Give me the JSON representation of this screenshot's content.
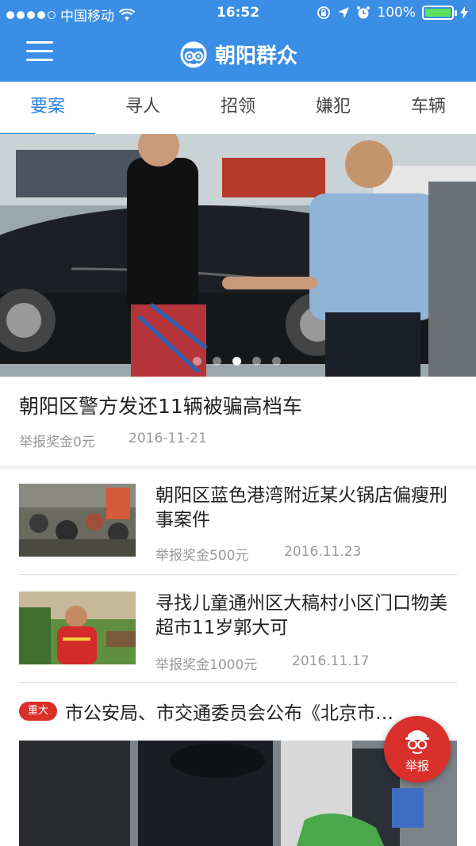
{
  "status": {
    "carrier": "中国移动",
    "time": "16:52",
    "battery": "100%"
  },
  "header": {
    "title": "朝阳群众"
  },
  "tabs": [
    "要案",
    "寻人",
    "招领",
    "嫌犯",
    "车辆"
  ],
  "hero": {
    "title": "朝阳区警方发还11辆被骗高档车",
    "reward": "举报奖金0元",
    "date": "2016-11-21",
    "page": 3,
    "pages": 5
  },
  "items": [
    {
      "title": "朝阳区蓝色港湾附近某火锅店偏瘦刑事案件",
      "reward": "举报奖金500元",
      "date": "2016.11.23"
    },
    {
      "title": "寻找儿童通州区大稿村小区门口物美超市11岁郭大可",
      "reward": "举报奖金1000元",
      "date": "2016.11.17"
    }
  ],
  "featured": {
    "badge": "重大",
    "title": "市公安局、市交通委员会公布《北京市…"
  },
  "fab": {
    "label": "举报"
  }
}
